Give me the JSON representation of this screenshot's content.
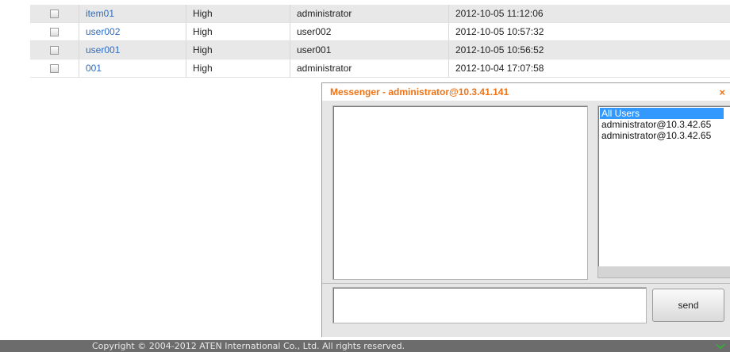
{
  "table": {
    "rows": [
      {
        "name": "item01",
        "level": "High",
        "user": "administrator",
        "time": "2012-10-05 11:12:06"
      },
      {
        "name": "user002",
        "level": "High",
        "user": "user002",
        "time": "2012-10-05 10:57:32"
      },
      {
        "name": "user001",
        "level": "High",
        "user": "user001",
        "time": "2012-10-05 10:56:52"
      },
      {
        "name": "001",
        "level": "High",
        "user": "administrator",
        "time": "2012-10-04 17:07:58"
      }
    ]
  },
  "messenger": {
    "title": "Messenger - administrator@10.3.41.141",
    "close_icon": "×",
    "users": [
      "All Users",
      "administrator@10.3.42.65",
      "administrator@10.3.42.65"
    ],
    "selected_user": "All Users",
    "message_value": "",
    "send_label": "send"
  },
  "footer": {
    "copyright": "Copyright © 2004-2012 ATEN International Co., Ltd. All rights reserved."
  },
  "colors": {
    "accent": "#f07214",
    "link": "#2b6cc4",
    "selection": "#3399ff",
    "footer_bg": "#6c6c6c"
  }
}
